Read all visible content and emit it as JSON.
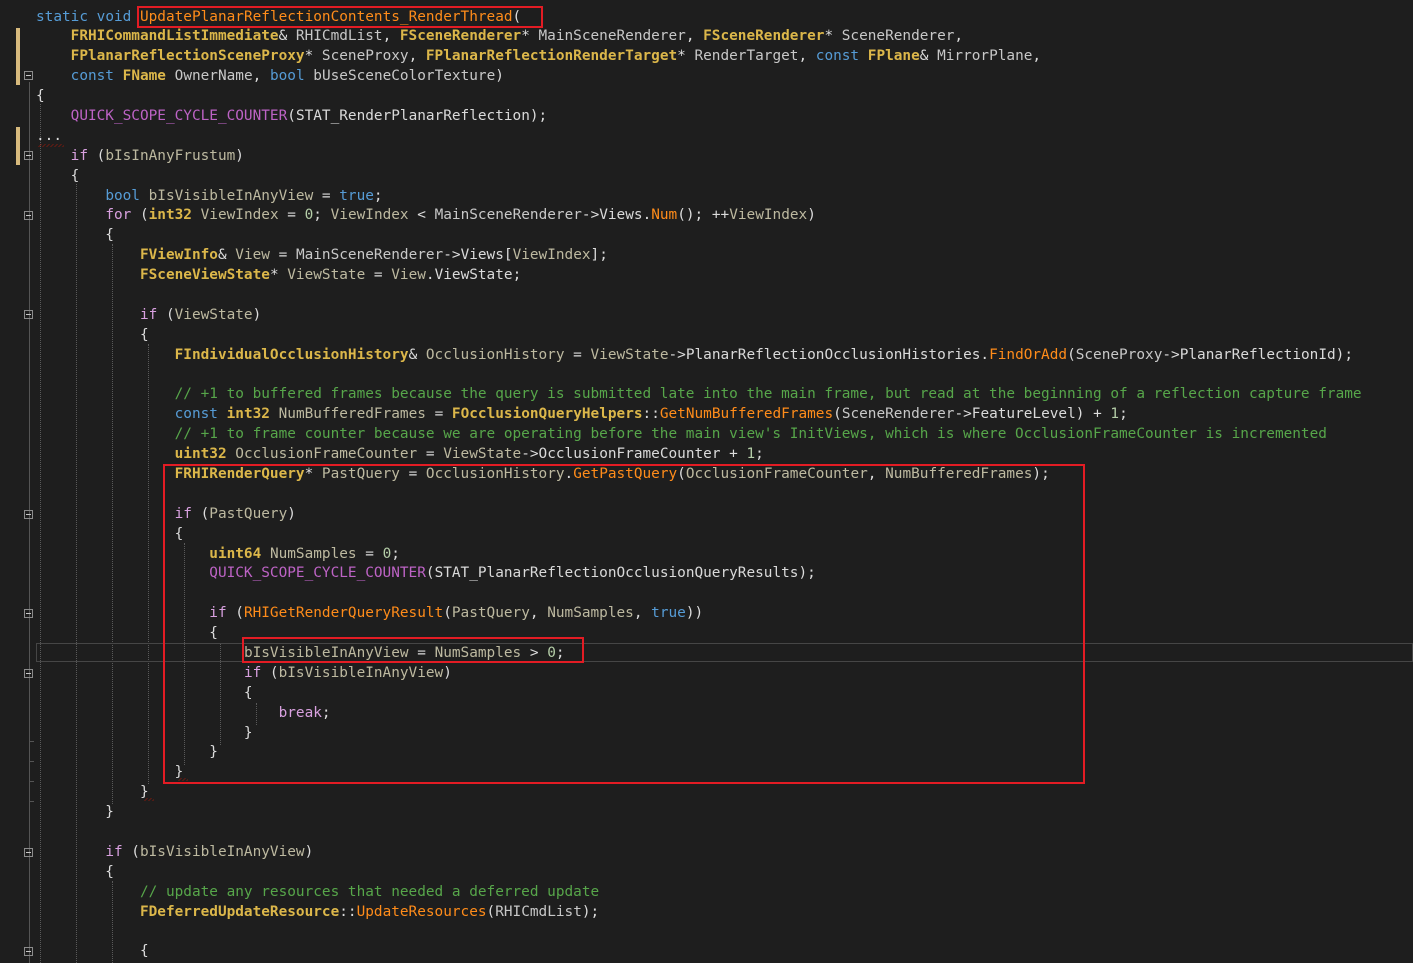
{
  "code": {
    "l1": [
      [
        "k",
        "static"
      ],
      [
        "pl",
        " "
      ],
      [
        "k",
        "void"
      ],
      [
        "pl",
        " "
      ],
      [
        "fn",
        "UpdatePlanarReflectionContents_RenderThread"
      ],
      [
        "pl",
        "("
      ]
    ],
    "l2": [
      [
        "pl",
        "    "
      ],
      [
        "ty2",
        "FRHICommandListImmediate"
      ],
      [
        "pl",
        "& "
      ],
      [
        "va",
        "RHICmdList"
      ],
      [
        "pl",
        ", "
      ],
      [
        "ty2",
        "FSceneRenderer"
      ],
      [
        "pl",
        "* "
      ],
      [
        "va",
        "MainSceneRenderer"
      ],
      [
        "pl",
        ", "
      ],
      [
        "ty2",
        "FSceneRenderer"
      ],
      [
        "pl",
        "* "
      ],
      [
        "va",
        "SceneRenderer"
      ],
      [
        "pl",
        ","
      ]
    ],
    "l3": [
      [
        "pl",
        "    "
      ],
      [
        "ty2",
        "FPlanarReflectionSceneProxy"
      ],
      [
        "pl",
        "* "
      ],
      [
        "va",
        "SceneProxy"
      ],
      [
        "pl",
        ", "
      ],
      [
        "ty2",
        "FPlanarReflectionRenderTarget"
      ],
      [
        "pl",
        "* "
      ],
      [
        "va",
        "RenderTarget"
      ],
      [
        "pl",
        ", "
      ],
      [
        "k",
        "const"
      ],
      [
        "pl",
        " "
      ],
      [
        "ty2",
        "FPlane"
      ],
      [
        "pl",
        "& "
      ],
      [
        "va",
        "MirrorPlane"
      ],
      [
        "pl",
        ","
      ]
    ],
    "l4": [
      [
        "pl",
        "    "
      ],
      [
        "k",
        "const"
      ],
      [
        "pl",
        " "
      ],
      [
        "ty2",
        "FName"
      ],
      [
        "pl",
        " "
      ],
      [
        "va",
        "OwnerName"
      ],
      [
        "pl",
        ", "
      ],
      [
        "k",
        "bool"
      ],
      [
        "pl",
        " "
      ],
      [
        "va",
        "bUseSceneColorTexture"
      ],
      [
        "pl",
        ")"
      ]
    ],
    "l5": [
      [
        "pl",
        "{"
      ]
    ],
    "l6": [
      [
        "pl",
        "    "
      ],
      [
        "mc",
        "QUICK_SCOPE_CYCLE_COUNTER"
      ],
      [
        "pl",
        "("
      ],
      [
        "mem",
        "STAT_RenderPlanarReflection"
      ],
      [
        "pl",
        ");"
      ]
    ],
    "l7": [
      [
        "pl",
        "..."
      ]
    ],
    "l8": [
      [
        "pl",
        "    "
      ],
      [
        "kw2",
        "if"
      ],
      [
        "pl",
        " ("
      ],
      [
        "id",
        "bIsInAnyFrustum"
      ],
      [
        "pl",
        ")"
      ]
    ],
    "l9": [
      [
        "pl",
        "    {"
      ]
    ],
    "l10": [
      [
        "pl",
        "        "
      ],
      [
        "k",
        "bool"
      ],
      [
        "pl",
        " "
      ],
      [
        "id",
        "bIsVisibleInAnyView"
      ],
      [
        "pl",
        " = "
      ],
      [
        "k",
        "true"
      ],
      [
        "pl",
        ";"
      ]
    ],
    "l11": [
      [
        "pl",
        "        "
      ],
      [
        "kw2",
        "for"
      ],
      [
        "pl",
        " ("
      ],
      [
        "ty2",
        "int32"
      ],
      [
        "pl",
        " "
      ],
      [
        "id",
        "ViewIndex"
      ],
      [
        "pl",
        " = "
      ],
      [
        "num",
        "0"
      ],
      [
        "pl",
        "; "
      ],
      [
        "id",
        "ViewIndex"
      ],
      [
        "pl",
        " < "
      ],
      [
        "va",
        "MainSceneRenderer"
      ],
      [
        "pl",
        "->"
      ],
      [
        "mem",
        "Views"
      ],
      [
        "pl",
        "."
      ],
      [
        "fn",
        "Num"
      ],
      [
        "pl",
        "(); ++"
      ],
      [
        "id",
        "ViewIndex"
      ],
      [
        "pl",
        ")"
      ]
    ],
    "l12": [
      [
        "pl",
        "        {"
      ]
    ],
    "l13": [
      [
        "pl",
        "            "
      ],
      [
        "ty2",
        "FViewInfo"
      ],
      [
        "pl",
        "& "
      ],
      [
        "id",
        "View"
      ],
      [
        "pl",
        " = "
      ],
      [
        "va",
        "MainSceneRenderer"
      ],
      [
        "pl",
        "->"
      ],
      [
        "mem",
        "Views"
      ],
      [
        "pl",
        "["
      ],
      [
        "id",
        "ViewIndex"
      ],
      [
        "pl",
        "];"
      ]
    ],
    "l14": [
      [
        "pl",
        "            "
      ],
      [
        "ty2",
        "FSceneViewState"
      ],
      [
        "pl",
        "* "
      ],
      [
        "id",
        "ViewState"
      ],
      [
        "pl",
        " = "
      ],
      [
        "id",
        "View"
      ],
      [
        "pl",
        "."
      ],
      [
        "mem",
        "ViewState"
      ],
      [
        "pl",
        ";"
      ]
    ],
    "l15": [
      [
        "pl",
        "            "
      ],
      [
        "kw2",
        "if"
      ],
      [
        "pl",
        " ("
      ],
      [
        "id",
        "ViewState"
      ],
      [
        "pl",
        ")"
      ]
    ],
    "l16": [
      [
        "pl",
        "            {"
      ]
    ],
    "l17": [
      [
        "pl",
        "                "
      ],
      [
        "ty2",
        "FIndividualOcclusionHistory"
      ],
      [
        "pl",
        "& "
      ],
      [
        "id",
        "OcclusionHistory"
      ],
      [
        "pl",
        " = "
      ],
      [
        "id",
        "ViewState"
      ],
      [
        "pl",
        "->"
      ],
      [
        "mem",
        "PlanarReflectionOcclusionHistories"
      ],
      [
        "pl",
        "."
      ],
      [
        "fn",
        "FindOrAdd"
      ],
      [
        "pl",
        "("
      ],
      [
        "va",
        "SceneProxy"
      ],
      [
        "pl",
        "->"
      ],
      [
        "mem",
        "PlanarReflectionId"
      ],
      [
        "pl",
        ");"
      ]
    ],
    "l18": [
      [
        "pl",
        "                "
      ],
      [
        "cm",
        "// +1 to buffered frames because the query is submitted late into the main frame, but read at the beginning of a reflection capture frame"
      ]
    ],
    "l19": [
      [
        "pl",
        "                "
      ],
      [
        "k",
        "const"
      ],
      [
        "pl",
        " "
      ],
      [
        "ty2",
        "int32"
      ],
      [
        "pl",
        " "
      ],
      [
        "id",
        "NumBufferedFrames"
      ],
      [
        "pl",
        " = "
      ],
      [
        "ty2",
        "FOcclusionQueryHelpers"
      ],
      [
        "pl",
        "::"
      ],
      [
        "fn",
        "GetNumBufferedFrames"
      ],
      [
        "pl",
        "("
      ],
      [
        "va",
        "SceneRenderer"
      ],
      [
        "pl",
        "->"
      ],
      [
        "mem",
        "FeatureLevel"
      ],
      [
        "pl",
        ") + "
      ],
      [
        "num",
        "1"
      ],
      [
        "pl",
        ";"
      ]
    ],
    "l20": [
      [
        "pl",
        "                "
      ],
      [
        "cm",
        "// +1 to frame counter because we are operating before the main view's InitViews, which is where OcclusionFrameCounter is incremented"
      ]
    ],
    "l21": [
      [
        "pl",
        "                "
      ],
      [
        "ty2",
        "uint32"
      ],
      [
        "pl",
        " "
      ],
      [
        "id",
        "OcclusionFrameCounter"
      ],
      [
        "pl",
        " = "
      ],
      [
        "id",
        "ViewState"
      ],
      [
        "pl",
        "->"
      ],
      [
        "mem",
        "OcclusionFrameCounter"
      ],
      [
        "pl",
        " + "
      ],
      [
        "num",
        "1"
      ],
      [
        "pl",
        ";"
      ]
    ],
    "l22": [
      [
        "pl",
        "                "
      ],
      [
        "ty2",
        "FRHIRenderQuery"
      ],
      [
        "pl",
        "* "
      ],
      [
        "id",
        "PastQuery"
      ],
      [
        "pl",
        " = "
      ],
      [
        "id",
        "OcclusionHistory"
      ],
      [
        "pl",
        "."
      ],
      [
        "fn",
        "GetPastQuery"
      ],
      [
        "pl",
        "("
      ],
      [
        "id",
        "OcclusionFrameCounter"
      ],
      [
        "pl",
        ", "
      ],
      [
        "id",
        "NumBufferedFrames"
      ],
      [
        "pl",
        ");"
      ]
    ],
    "l23": [
      [
        "pl",
        "                "
      ],
      [
        "kw2",
        "if"
      ],
      [
        "pl",
        " ("
      ],
      [
        "id",
        "PastQuery"
      ],
      [
        "pl",
        ")"
      ]
    ],
    "l24": [
      [
        "pl",
        "                {"
      ]
    ],
    "l25": [
      [
        "pl",
        "                    "
      ],
      [
        "ty2",
        "uint64"
      ],
      [
        "pl",
        " "
      ],
      [
        "id",
        "NumSamples"
      ],
      [
        "pl",
        " = "
      ],
      [
        "num",
        "0"
      ],
      [
        "pl",
        ";"
      ]
    ],
    "l26": [
      [
        "pl",
        "                    "
      ],
      [
        "mc",
        "QUICK_SCOPE_CYCLE_COUNTER"
      ],
      [
        "pl",
        "("
      ],
      [
        "mem",
        "STAT_PlanarReflectionOcclusionQueryResults"
      ],
      [
        "pl",
        ");"
      ]
    ],
    "l27": [
      [
        "pl",
        "                    "
      ],
      [
        "kw2",
        "if"
      ],
      [
        "pl",
        " ("
      ],
      [
        "fn",
        "RHIGetRenderQueryResult"
      ],
      [
        "pl",
        "("
      ],
      [
        "id",
        "PastQuery"
      ],
      [
        "pl",
        ", "
      ],
      [
        "id",
        "NumSamples"
      ],
      [
        "pl",
        ", "
      ],
      [
        "k",
        "true"
      ],
      [
        "pl",
        "))"
      ]
    ],
    "l28": [
      [
        "pl",
        "                    {"
      ]
    ],
    "l29": [
      [
        "pl",
        "                        "
      ],
      [
        "id",
        "bIsVisibleInAnyView"
      ],
      [
        "pl",
        " = "
      ],
      [
        "id",
        "NumSamples"
      ],
      [
        "pl",
        " > "
      ],
      [
        "num",
        "0"
      ],
      [
        "pl",
        ";"
      ]
    ],
    "l30": [
      [
        "pl",
        "                        "
      ],
      [
        "kw2",
        "if"
      ],
      [
        "pl",
        " ("
      ],
      [
        "id",
        "bIsVisibleInAnyView"
      ],
      [
        "pl",
        ")"
      ]
    ],
    "l31": [
      [
        "pl",
        "                        {"
      ]
    ],
    "l32": [
      [
        "pl",
        "                            "
      ],
      [
        "kw2",
        "break"
      ],
      [
        "pl",
        ";"
      ]
    ],
    "l33": [
      [
        "pl",
        "                        }"
      ]
    ],
    "l34": [
      [
        "pl",
        "                    }"
      ]
    ],
    "l35": [
      [
        "pl",
        "                }"
      ]
    ],
    "l36": [
      [
        "pl",
        "            }"
      ]
    ],
    "l37": [
      [
        "pl",
        "        }"
      ]
    ],
    "l38": [
      [
        "pl",
        "        "
      ],
      [
        "kw2",
        "if"
      ],
      [
        "pl",
        " ("
      ],
      [
        "id",
        "bIsVisibleInAnyView"
      ],
      [
        "pl",
        ")"
      ]
    ],
    "l39": [
      [
        "pl",
        "        {"
      ]
    ],
    "l40": [
      [
        "pl",
        "            "
      ],
      [
        "cm",
        "// update any resources that needed a deferred update"
      ]
    ],
    "l41": [
      [
        "pl",
        "            "
      ],
      [
        "ty2",
        "FDeferredUpdateResource"
      ],
      [
        "pl",
        "::"
      ],
      [
        "fn",
        "UpdateResources"
      ],
      [
        "pl",
        "("
      ],
      [
        "va",
        "RHICmdList"
      ],
      [
        "pl",
        ");"
      ]
    ],
    "l42": [
      [
        "pl",
        "            {"
      ]
    ]
  }
}
